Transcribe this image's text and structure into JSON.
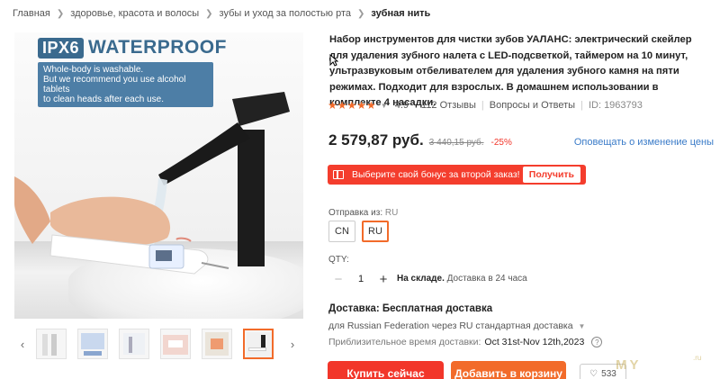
{
  "breadcrumb": [
    "Главная",
    "здоровье, красота и волосы",
    "зубы и уход за полостью рта",
    "зубная нить"
  ],
  "image": {
    "badge_ipx": "IPX6",
    "badge_text": "WATERPROOF",
    "note_lines": [
      "Whole-body is washable.",
      "But we recommend you use alcohol tablets",
      "to clean heads after each use."
    ]
  },
  "thumbnails": {
    "count": 7,
    "active_index": 6,
    "prev": "‹",
    "next": "›"
  },
  "product": {
    "title": "Набор инструментов для чистки зубов УАЛАНС: электрический скейлер для удаления зубного налета с LED-подсветкой, таймером на 10 минут, ультразвуковым отбеливателем для удаления зубного камня на пяти режимах. Подходит для взрослых. В домашнем использовании в комплекте 4 насадки.",
    "stars": "★★★★★",
    "rating": "4.9",
    "reviews": "112 Отзывы",
    "qa": "Вопросы и Ответы",
    "id": "ID: 1963793"
  },
  "price": {
    "current": "2 579,87 руб.",
    "old": "3 440,15 руб.",
    "discount": "-25%",
    "notify": "Оповещать о изменение цены"
  },
  "bonus": {
    "text": "Выберите свой бонус за второй заказ!",
    "button": "Получить"
  },
  "shipping_from": {
    "label": "Отправка из:",
    "value": "RU",
    "options": [
      "CN",
      "RU"
    ],
    "selected": "RU"
  },
  "quantity": {
    "label": "QTY:",
    "value": "1",
    "minus": "−",
    "plus": "+",
    "stock_bold": "На складе.",
    "stock": "Доставка в 24 часа"
  },
  "delivery": {
    "title_bold": "Доставка:",
    "title_rest": "Бесплатная доставка",
    "line": "для Russian Federation через RU стандартная доставка",
    "eta_label": "Приблизительное время доставки:",
    "eta_date": "Oct 31st-Nov 12th,2023",
    "info": "?"
  },
  "actions": {
    "buy_now": "Купить сейчас",
    "add_cart": "Добавить в корзину",
    "wishlist": "533"
  },
  "watermark": {
    "main": "MY",
    "small": ".ru"
  },
  "colors": {
    "accent": "#f26b2a",
    "red": "#f2362a",
    "link": "#3a7bc8",
    "badge": "#3a6a8e"
  }
}
